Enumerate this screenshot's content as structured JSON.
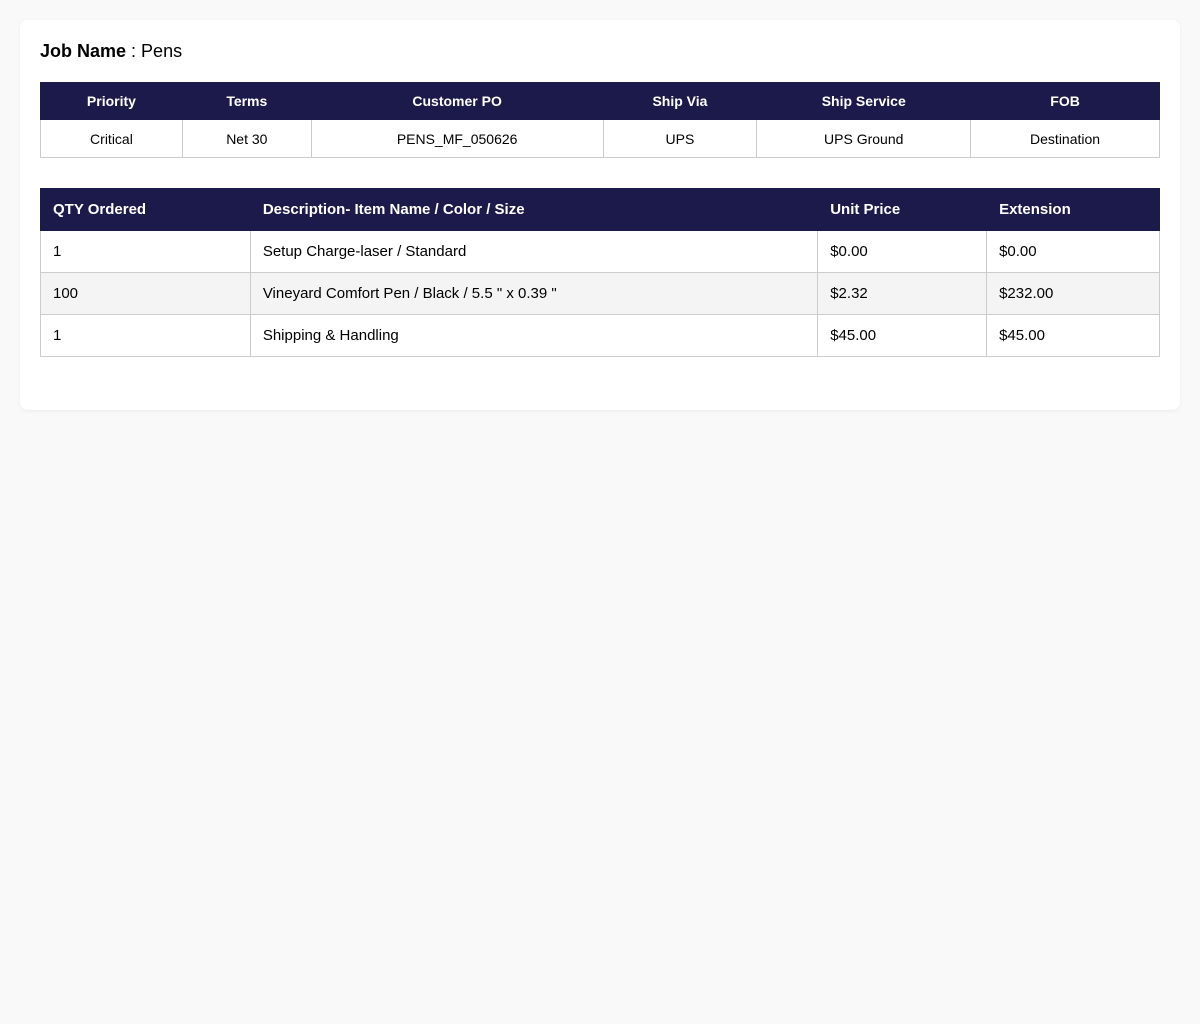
{
  "job": {
    "label": "Job Name",
    "separator": " : ",
    "value": "Pens"
  },
  "info_table": {
    "headers": [
      "Priority",
      "Terms",
      "Customer PO",
      "Ship Via",
      "Ship Service",
      "FOB"
    ],
    "values": [
      "Critical",
      "Net 30",
      "PENS_MF_050626",
      "UPS",
      "UPS Ground",
      "Destination"
    ]
  },
  "items_table": {
    "headers": [
      "QTY Ordered",
      "Description- Item Name / Color / Size",
      "Unit Price",
      "Extension"
    ],
    "rows": [
      {
        "qty": "1",
        "description": "Setup Charge-laser / Standard",
        "unit_price": "$0.00",
        "extension": "$0.00"
      },
      {
        "qty": "100",
        "description": "Vineyard Comfort Pen / Black / 5.5 \" x 0.39 \"",
        "unit_price": "$2.32",
        "extension": "$232.00"
      },
      {
        "qty": "1",
        "description": "Shipping & Handling",
        "unit_price": "$45.00",
        "extension": "$45.00"
      }
    ]
  },
  "colors": {
    "header_bg": "#1c1a4a",
    "header_text": "#ffffff",
    "page_bg": "#f9f9f9",
    "alt_row_bg": "#f4f4f4"
  }
}
